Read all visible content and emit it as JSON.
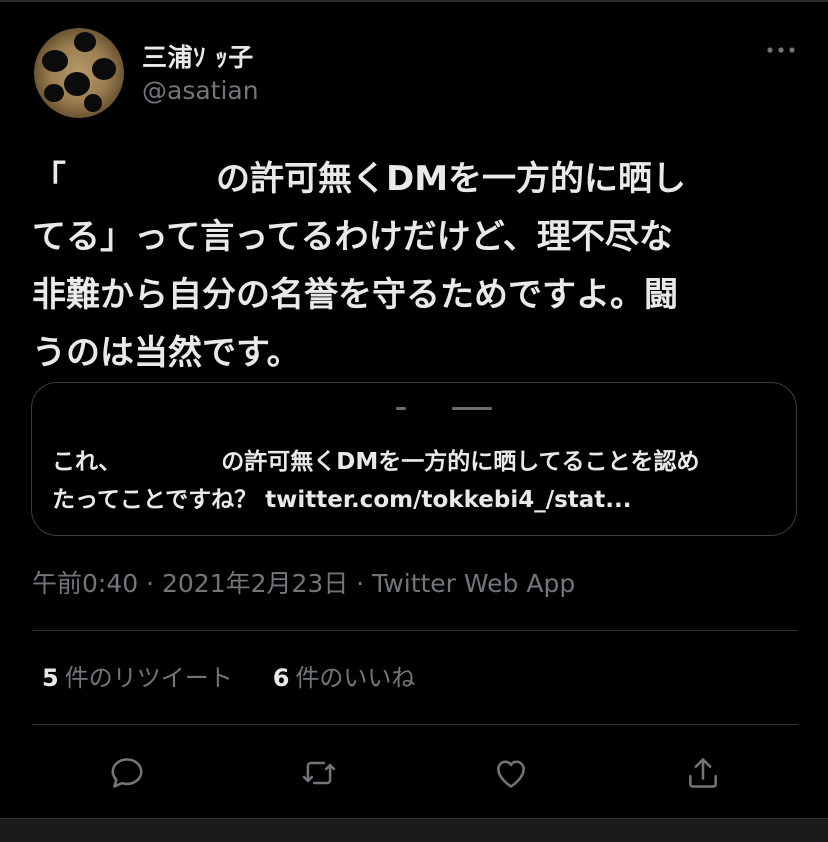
{
  "author": {
    "name": "三浦ｿ ｯ子",
    "handle": "@asatian"
  },
  "tweet": {
    "line1_open": "「",
    "line1_rest": "の許可無くDMを一方的に晒し",
    "lines_rest": "てる」って言ってるわけだけど、理不尽な\n非難から自分の名誉を守るためですよ。闘\nうのは当然です。"
  },
  "quote": {
    "text_start": "これ、",
    "text_rest": "の許可無くDMを一方的に晒してることを認め\nたってことですね？ twitter.com/tokkebi4_/stat..."
  },
  "meta": {
    "time": "午前0:40",
    "date": "2021年2月23日",
    "separator": " · ",
    "app": "Twitter Web App"
  },
  "stats": {
    "retweets_count": "5",
    "retweets_label": "件のリツイート",
    "likes_count": "6",
    "likes_label": "件のいいね"
  },
  "icons": {
    "reply": "reply-icon",
    "retweet": "retweet-icon",
    "like": "like-icon",
    "share": "share-icon",
    "more": "more-icon"
  },
  "colors": {
    "background": "#000000",
    "text": "#e7e9ea",
    "secondary": "#71767b",
    "border": "#2f3336"
  }
}
